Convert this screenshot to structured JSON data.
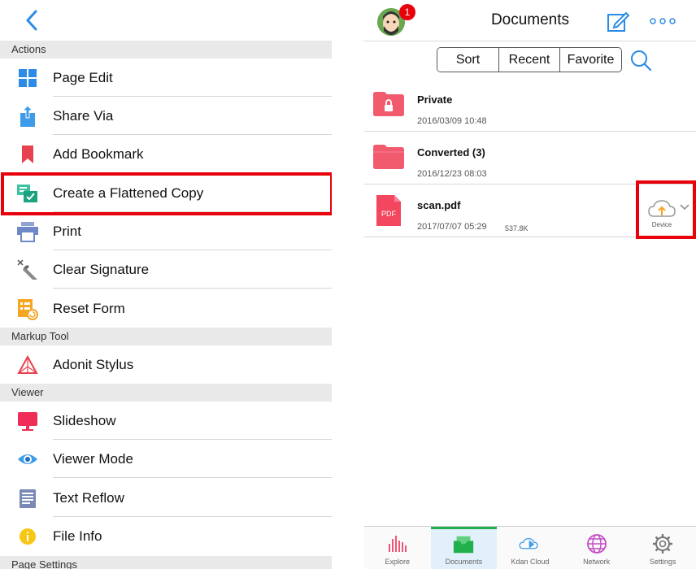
{
  "left_panel": {
    "sections": {
      "actions": "Actions",
      "markup_tool": "Markup Tool",
      "viewer": "Viewer",
      "page_settings": "Page Settings"
    },
    "items": {
      "page_edit": {
        "label": "Page Edit",
        "icon": "grid-icon"
      },
      "share_via": {
        "label": "Share Via",
        "icon": "share-icon"
      },
      "add_bookmark": {
        "label": "Add Bookmark",
        "icon": "bookmark-icon"
      },
      "flattened_copy": {
        "label": "Create a Flattened Copy",
        "icon": "flatten-copy-icon"
      },
      "print": {
        "label": "Print",
        "icon": "printer-icon"
      },
      "clear_signature": {
        "label": "Clear Signature",
        "icon": "pen-x-icon"
      },
      "reset_form": {
        "label": "Reset Form",
        "icon": "form-reset-icon"
      },
      "adonit_stylus": {
        "label": "Adonit Stylus",
        "icon": "adonit-icon"
      },
      "slideshow": {
        "label": "Slideshow",
        "icon": "slideshow-icon"
      },
      "viewer_mode": {
        "label": "Viewer Mode",
        "icon": "eye-icon"
      },
      "text_reflow": {
        "label": "Text Reflow",
        "icon": "text-reflow-icon"
      },
      "file_info": {
        "label": "File Info",
        "icon": "info-icon"
      }
    }
  },
  "right_panel": {
    "title": "Documents",
    "badge_count": "1",
    "segments": [
      "Sort",
      "Recent",
      "Favorite"
    ],
    "files": [
      {
        "name": "Private",
        "date": "2016/03/09 10:48",
        "size": "",
        "type": "locked-folder"
      },
      {
        "name": "Converted (3)",
        "date": "2016/12/23 08:03",
        "size": "",
        "type": "folder"
      },
      {
        "name": "scan.pdf",
        "date": "2017/07/07 05:29",
        "size": "537.8K",
        "type": "pdf",
        "pdf_label": "PDF"
      }
    ],
    "device_label": "Device",
    "tabs": [
      {
        "label": "Explore",
        "icon": "explore-icon",
        "active": false
      },
      {
        "label": "Documents",
        "icon": "documents-tray-icon",
        "active": true
      },
      {
        "label": "Kdan Cloud",
        "icon": "kdan-cloud-icon",
        "active": false
      },
      {
        "label": "Network",
        "icon": "globe-icon",
        "active": false
      },
      {
        "label": "Settings",
        "icon": "gear-icon",
        "active": false
      }
    ]
  },
  "colors": {
    "accent_blue": "#2b8be6",
    "highlight_red": "#e8000b",
    "folder_red": "#f25a6e",
    "active_tab_green": "#21b04b"
  }
}
